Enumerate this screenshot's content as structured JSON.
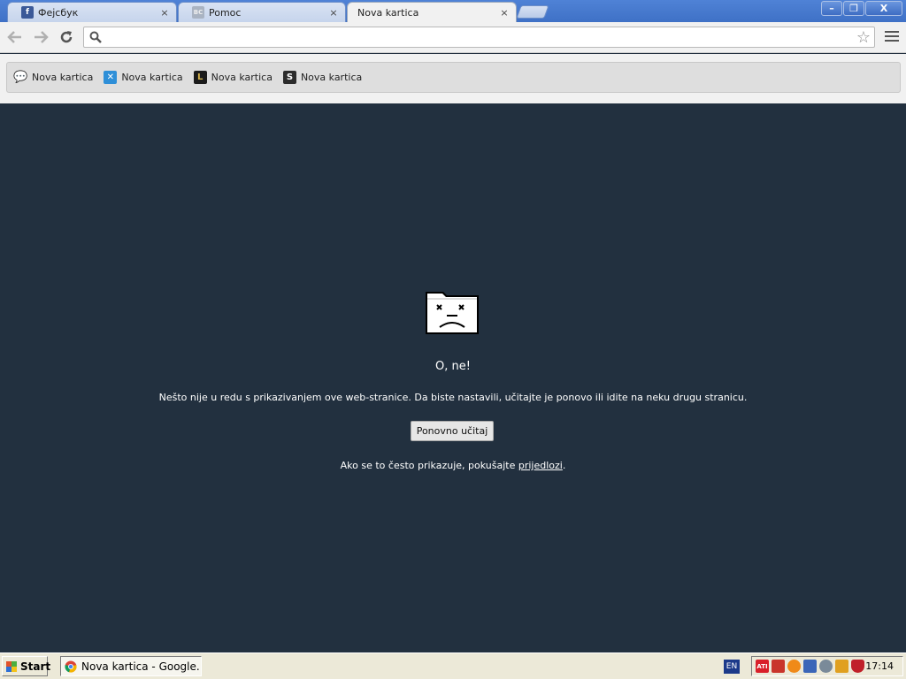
{
  "tabs": [
    {
      "title": "Фејсбук",
      "icon": "facebook-icon"
    },
    {
      "title": "Pomoc",
      "icon": "site-icon"
    },
    {
      "title": "Nova kartica",
      "icon": "none",
      "active": true
    }
  ],
  "tab_close_glyph": "×",
  "window_controls": {
    "minimize": "–",
    "restore": "❐",
    "close": "X"
  },
  "omnibox": {
    "value": "",
    "placeholder": ""
  },
  "bookmarks": [
    {
      "label": "Nova kartica",
      "icon": "chat-bubble-icon"
    },
    {
      "label": "Nova kartica",
      "icon": "x-logo-icon"
    },
    {
      "label": "Nova kartica",
      "icon": "l-logo-icon"
    },
    {
      "label": "Nova kartica",
      "icon": "s-logo-icon"
    }
  ],
  "error": {
    "title": "O, ne!",
    "message": "Nešto nije u redu s prikazivanjem ove web-stranice. Da biste nastavili, učitajte je ponovo ili idite na neku drugu stranicu.",
    "reload_label": "Ponovno učitaj",
    "help_prefix": "Ako se to često prikazuje, pokušajte ",
    "help_link": "prijedlozi",
    "help_suffix": "."
  },
  "taskbar": {
    "start_label": "Start",
    "app_label": "Nova kartica - Google...",
    "lang": "EN",
    "tray_badge": "ATI",
    "clock": "17:14"
  },
  "colors": {
    "content_bg": "#22303f",
    "titlebar": "#3f71c6"
  }
}
